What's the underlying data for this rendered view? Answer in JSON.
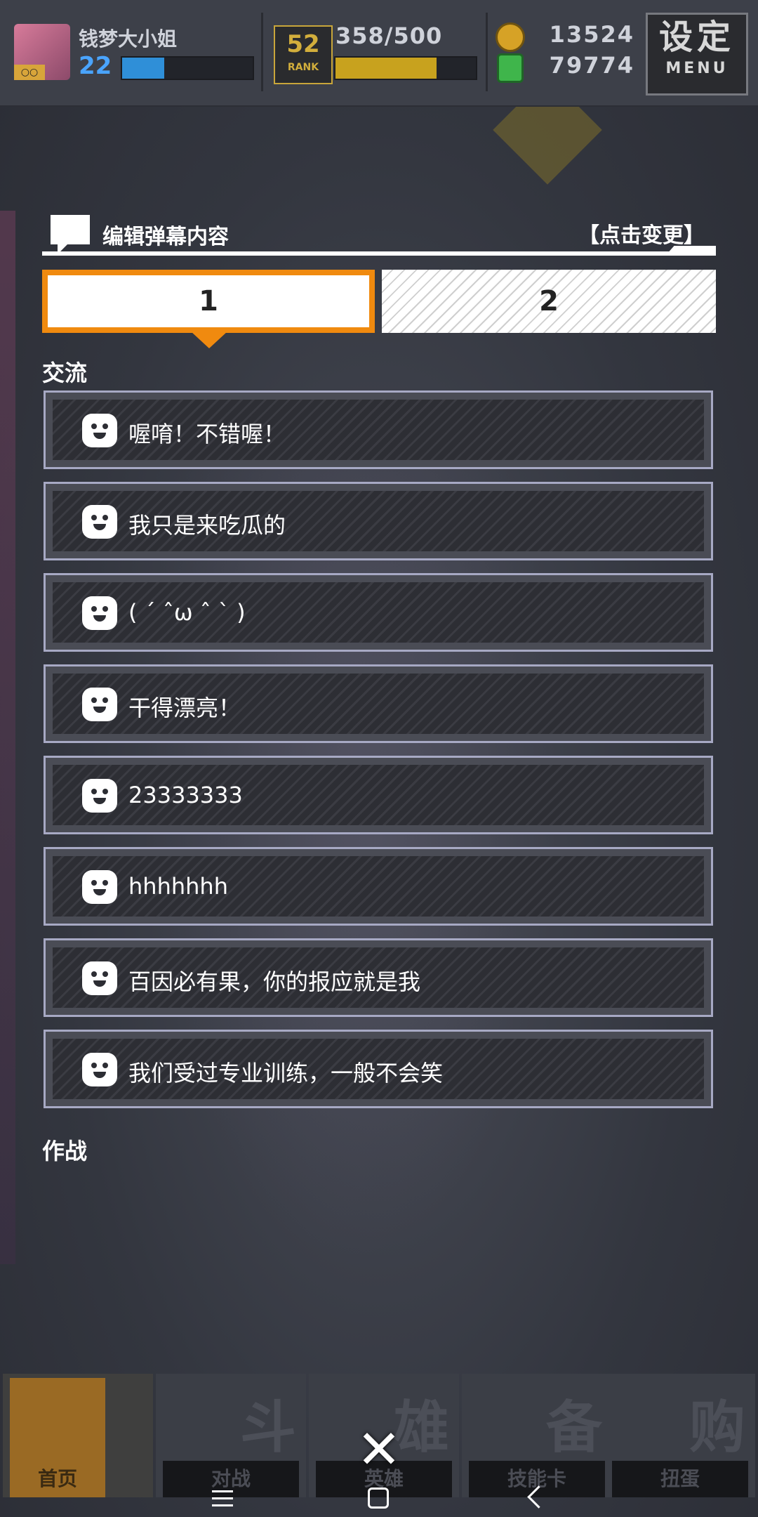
{
  "status_bar": {
    "player_name": "钱梦大小姐",
    "player_level": "22",
    "xp_fill": 0.32,
    "rank_number": "52",
    "rank_label": "RANK",
    "stamina": "358/500",
    "stamina_fill": 0.72,
    "coins": "13524",
    "gems": "79774",
    "menu_big": "设定",
    "menu_small": "MENU"
  },
  "panel": {
    "title": "编辑弹幕内容",
    "action": "【点击变更】",
    "tabs": [
      {
        "label": "1",
        "selected": true
      },
      {
        "label": "2",
        "selected": false
      }
    ],
    "sections": [
      {
        "label": "交流",
        "phrases": [
          "喔唷！不错喔！",
          "我只是来吃瓜的",
          "( ´ ˆω ˆ ` )",
          "干得漂亮！",
          "23333333",
          "hhhhhhh",
          "百因必有果，你的报应就是我",
          "我们受过专业训练，一般不会笑"
        ]
      },
      {
        "label": "作战",
        "phrases": []
      }
    ]
  },
  "bottom_nav": {
    "items": [
      {
        "label": "首页",
        "big": ""
      },
      {
        "label": "对战",
        "big": "斗"
      },
      {
        "label": "英雄",
        "big": "雄"
      },
      {
        "label": "技能卡",
        "big": "备"
      },
      {
        "label": "扭蛋",
        "big": "购"
      }
    ],
    "close_symbol": "✕"
  },
  "colors": {
    "accent_orange": "#f08a0f",
    "phrase_border": "#a7a9c4",
    "xp_blue": "#2f8fd8",
    "stamina_gold": "#c8a21e"
  }
}
